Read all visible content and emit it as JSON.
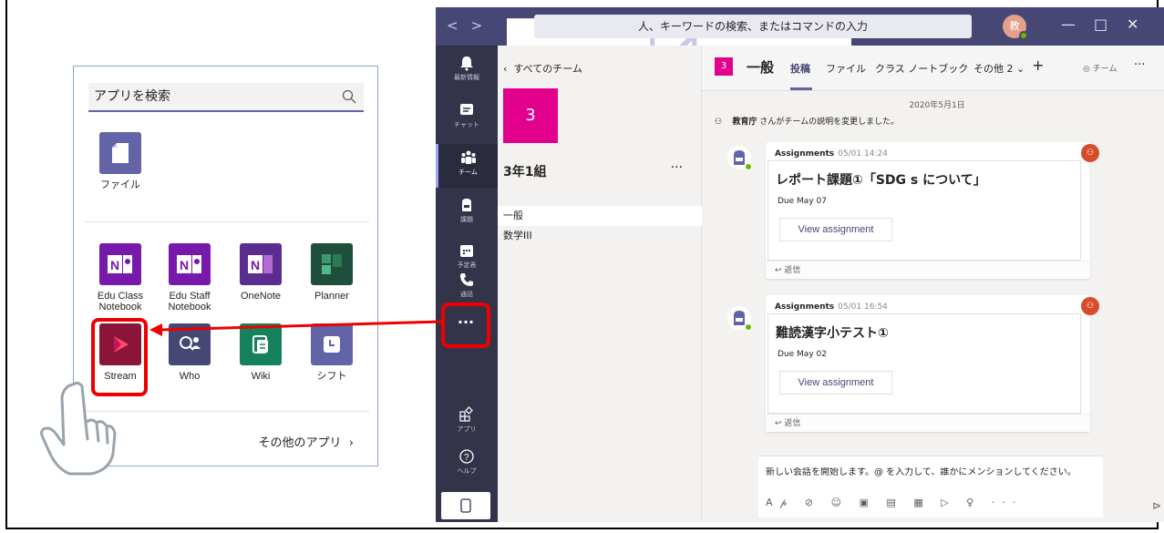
{
  "picker": {
    "search_placeholder": "アプリを検索",
    "pinned": [
      {
        "label": "ファイル",
        "icon": "file-icon"
      }
    ],
    "apps_row1": [
      {
        "label": "Edu Class Notebook",
        "icon": "onenote-class-icon"
      },
      {
        "label": "Edu Staff Notebook",
        "icon": "onenote-staff-icon"
      },
      {
        "label": "OneNote",
        "icon": "onenote-icon"
      },
      {
        "label": "Planner",
        "icon": "planner-icon"
      }
    ],
    "apps_row2": [
      {
        "label": "Stream",
        "icon": "stream-icon"
      },
      {
        "label": "Who",
        "icon": "who-icon"
      },
      {
        "label": "Wiki",
        "icon": "wiki-icon"
      },
      {
        "label": "シフト",
        "icon": "shifts-icon"
      }
    ],
    "more_apps": "その他のアプリ",
    "more_chevron": "›"
  },
  "teams": {
    "nav_back": "<",
    "nav_fwd": ">",
    "command_placeholder": "人、キーワードの検索、またはコマンドの入力",
    "avatar_initial": "教",
    "rail": [
      {
        "label": "最新情報",
        "icon": "bell-icon"
      },
      {
        "label": "チャット",
        "icon": "chat-icon"
      },
      {
        "label": "チーム",
        "icon": "teams-icon"
      },
      {
        "label": "課題",
        "icon": "assignment-icon"
      },
      {
        "label": "予定表",
        "icon": "calendar-icon"
      },
      {
        "label": "通話",
        "icon": "phone-icon"
      }
    ],
    "rail_more": "···",
    "rail_bottom": [
      {
        "label": "アプリ",
        "icon": "apps-icon"
      },
      {
        "label": "ヘルプ",
        "icon": "help-icon"
      }
    ],
    "all_teams": "すべてのチーム",
    "team_number": "3",
    "team_name": "3年1組",
    "team_dots": "···",
    "channels": [
      "一般",
      "数学III"
    ],
    "header": {
      "badge": "3",
      "title": "一般",
      "tabs": [
        "投稿",
        "ファイル",
        "クラス ノートブック",
        "その他 2"
      ],
      "plus": "+",
      "team_label": "チーム",
      "dots": "···"
    },
    "date": "2020年5月1日",
    "system_message_actor": "教育庁",
    "system_message_text": " さんがチームの説明を変更しました。",
    "posts": [
      {
        "app": "Assignments",
        "time": "05/01 14:24",
        "title": "レポート課題①「SDG s について」",
        "due": "Due May 07",
        "button": "View assignment",
        "reply": "返信"
      },
      {
        "app": "Assignments",
        "time": "05/01 16:54",
        "title": "難読漢字小テスト①",
        "due": "Due May 02",
        "button": "View assignment",
        "reply": "返信"
      }
    ],
    "compose_placeholder": "新しい会話を開始します。@ を入力して、誰かにメンションしてください。",
    "compose_tools": "A𝓅 ⊘ ☺ ▣ ▤ ▦ ▷ ♀ ···",
    "send": "⊳"
  },
  "colors": {
    "accent": "#6264a7",
    "titlebar": "#464775",
    "rail": "#33344a",
    "highlight": "#e00000",
    "team": "#e3008c"
  }
}
